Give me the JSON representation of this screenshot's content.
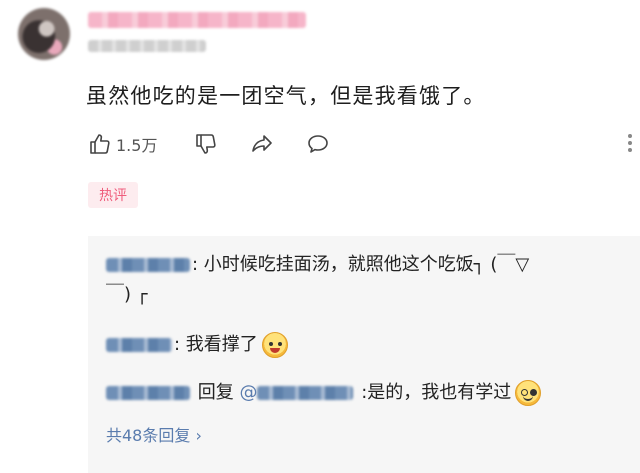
{
  "comment": {
    "text": "虽然他吃的是一团空气，但是我看饿了。",
    "like_count": "1.5万",
    "hot_tag": "热评"
  },
  "replies": [
    {
      "separator": ": ",
      "text": "小时候吃挂面汤，就照他这个吃饭┐ (￣▽",
      "text_cont": "￣) ┌"
    },
    {
      "separator": ": ",
      "text": "我看撑了"
    },
    {
      "reply_word": "回复",
      "mention": "@",
      "separator": " :",
      "text": "是的，我也有学过"
    }
  ],
  "more_replies": "共48条回复 ›",
  "icons": [
    "thumbs-up-icon",
    "thumbs-down-icon",
    "share-icon",
    "comment-icon",
    "more-icon",
    "laughing-emoji-icon",
    "smirk-emoji-icon"
  ],
  "colors": {
    "hot_tag_bg": "#fdecef",
    "hot_tag_text": "#ef5d7c",
    "link": "#5a7cae"
  }
}
